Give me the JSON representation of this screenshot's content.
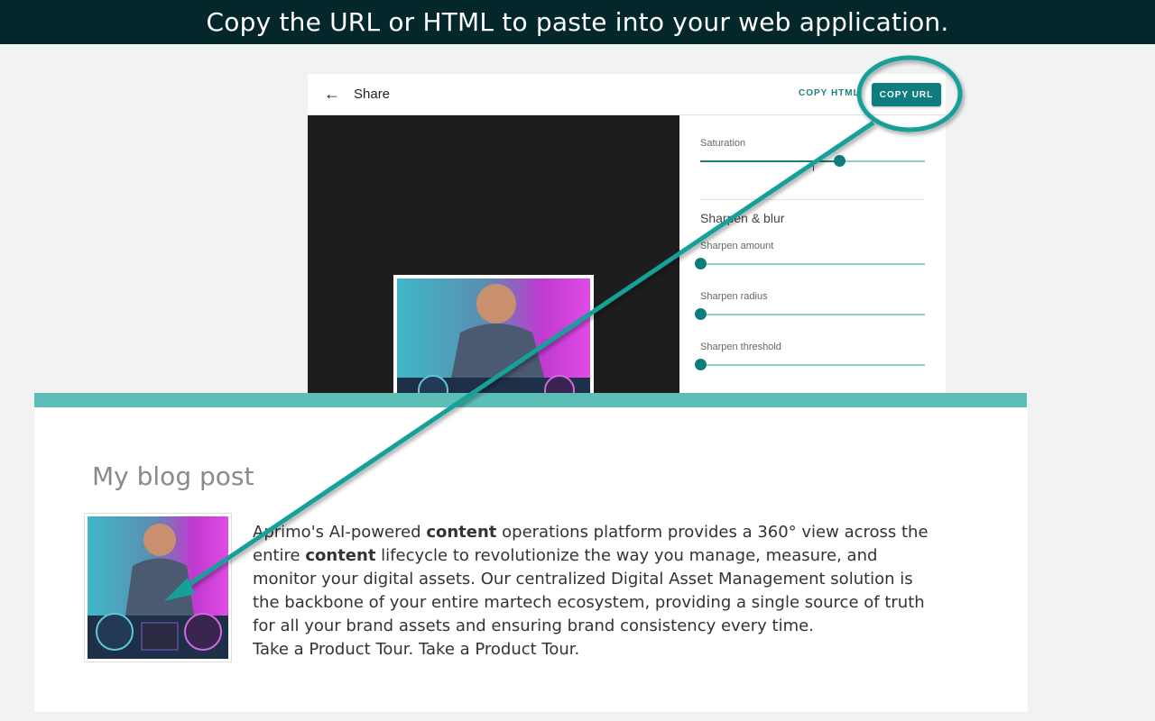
{
  "banner": {
    "text": "Copy the URL or HTML to paste into your web application."
  },
  "share_panel": {
    "title": "Share",
    "copy_html_label": "COPY HTML",
    "copy_url_label": "COPY URL",
    "saturation": {
      "label": "Saturation",
      "value_fraction": 0.62
    },
    "sharpen_section_title": "Sharpen & blur",
    "sharpen_amount": {
      "label": "Sharpen amount",
      "value_fraction": 0.0
    },
    "sharpen_radius": {
      "label": "Sharpen radius",
      "value_fraction": 0.0
    },
    "sharpen_threshold": {
      "label": "Sharpen threshold",
      "value_fraction": 0.0
    }
  },
  "blog": {
    "title": "My blog post",
    "paragraph": {
      "t1": "Aprimo's AI-powered ",
      "b1": "content",
      "t2": " operations platform provides a 360° view across the entire ",
      "b2": "content",
      "t3": " lifecycle to revolutionize the way you manage, measure, and monitor your digital assets. Our centralized Digital Asset Management solution is the backbone of your entire martech ecosystem, providing a single source of truth for all your brand assets and ensuring brand consistency every time.",
      "tour": "Take a Product Tour. Take a Product Tour."
    }
  },
  "colors": {
    "teal": "#0f7d80",
    "banner_bg": "#03272b",
    "arrow": "#17a09a",
    "blog_bar": "#5bbfb8"
  },
  "icons": {
    "back": "arrow-left-icon",
    "photo": "dj-photo-image"
  }
}
